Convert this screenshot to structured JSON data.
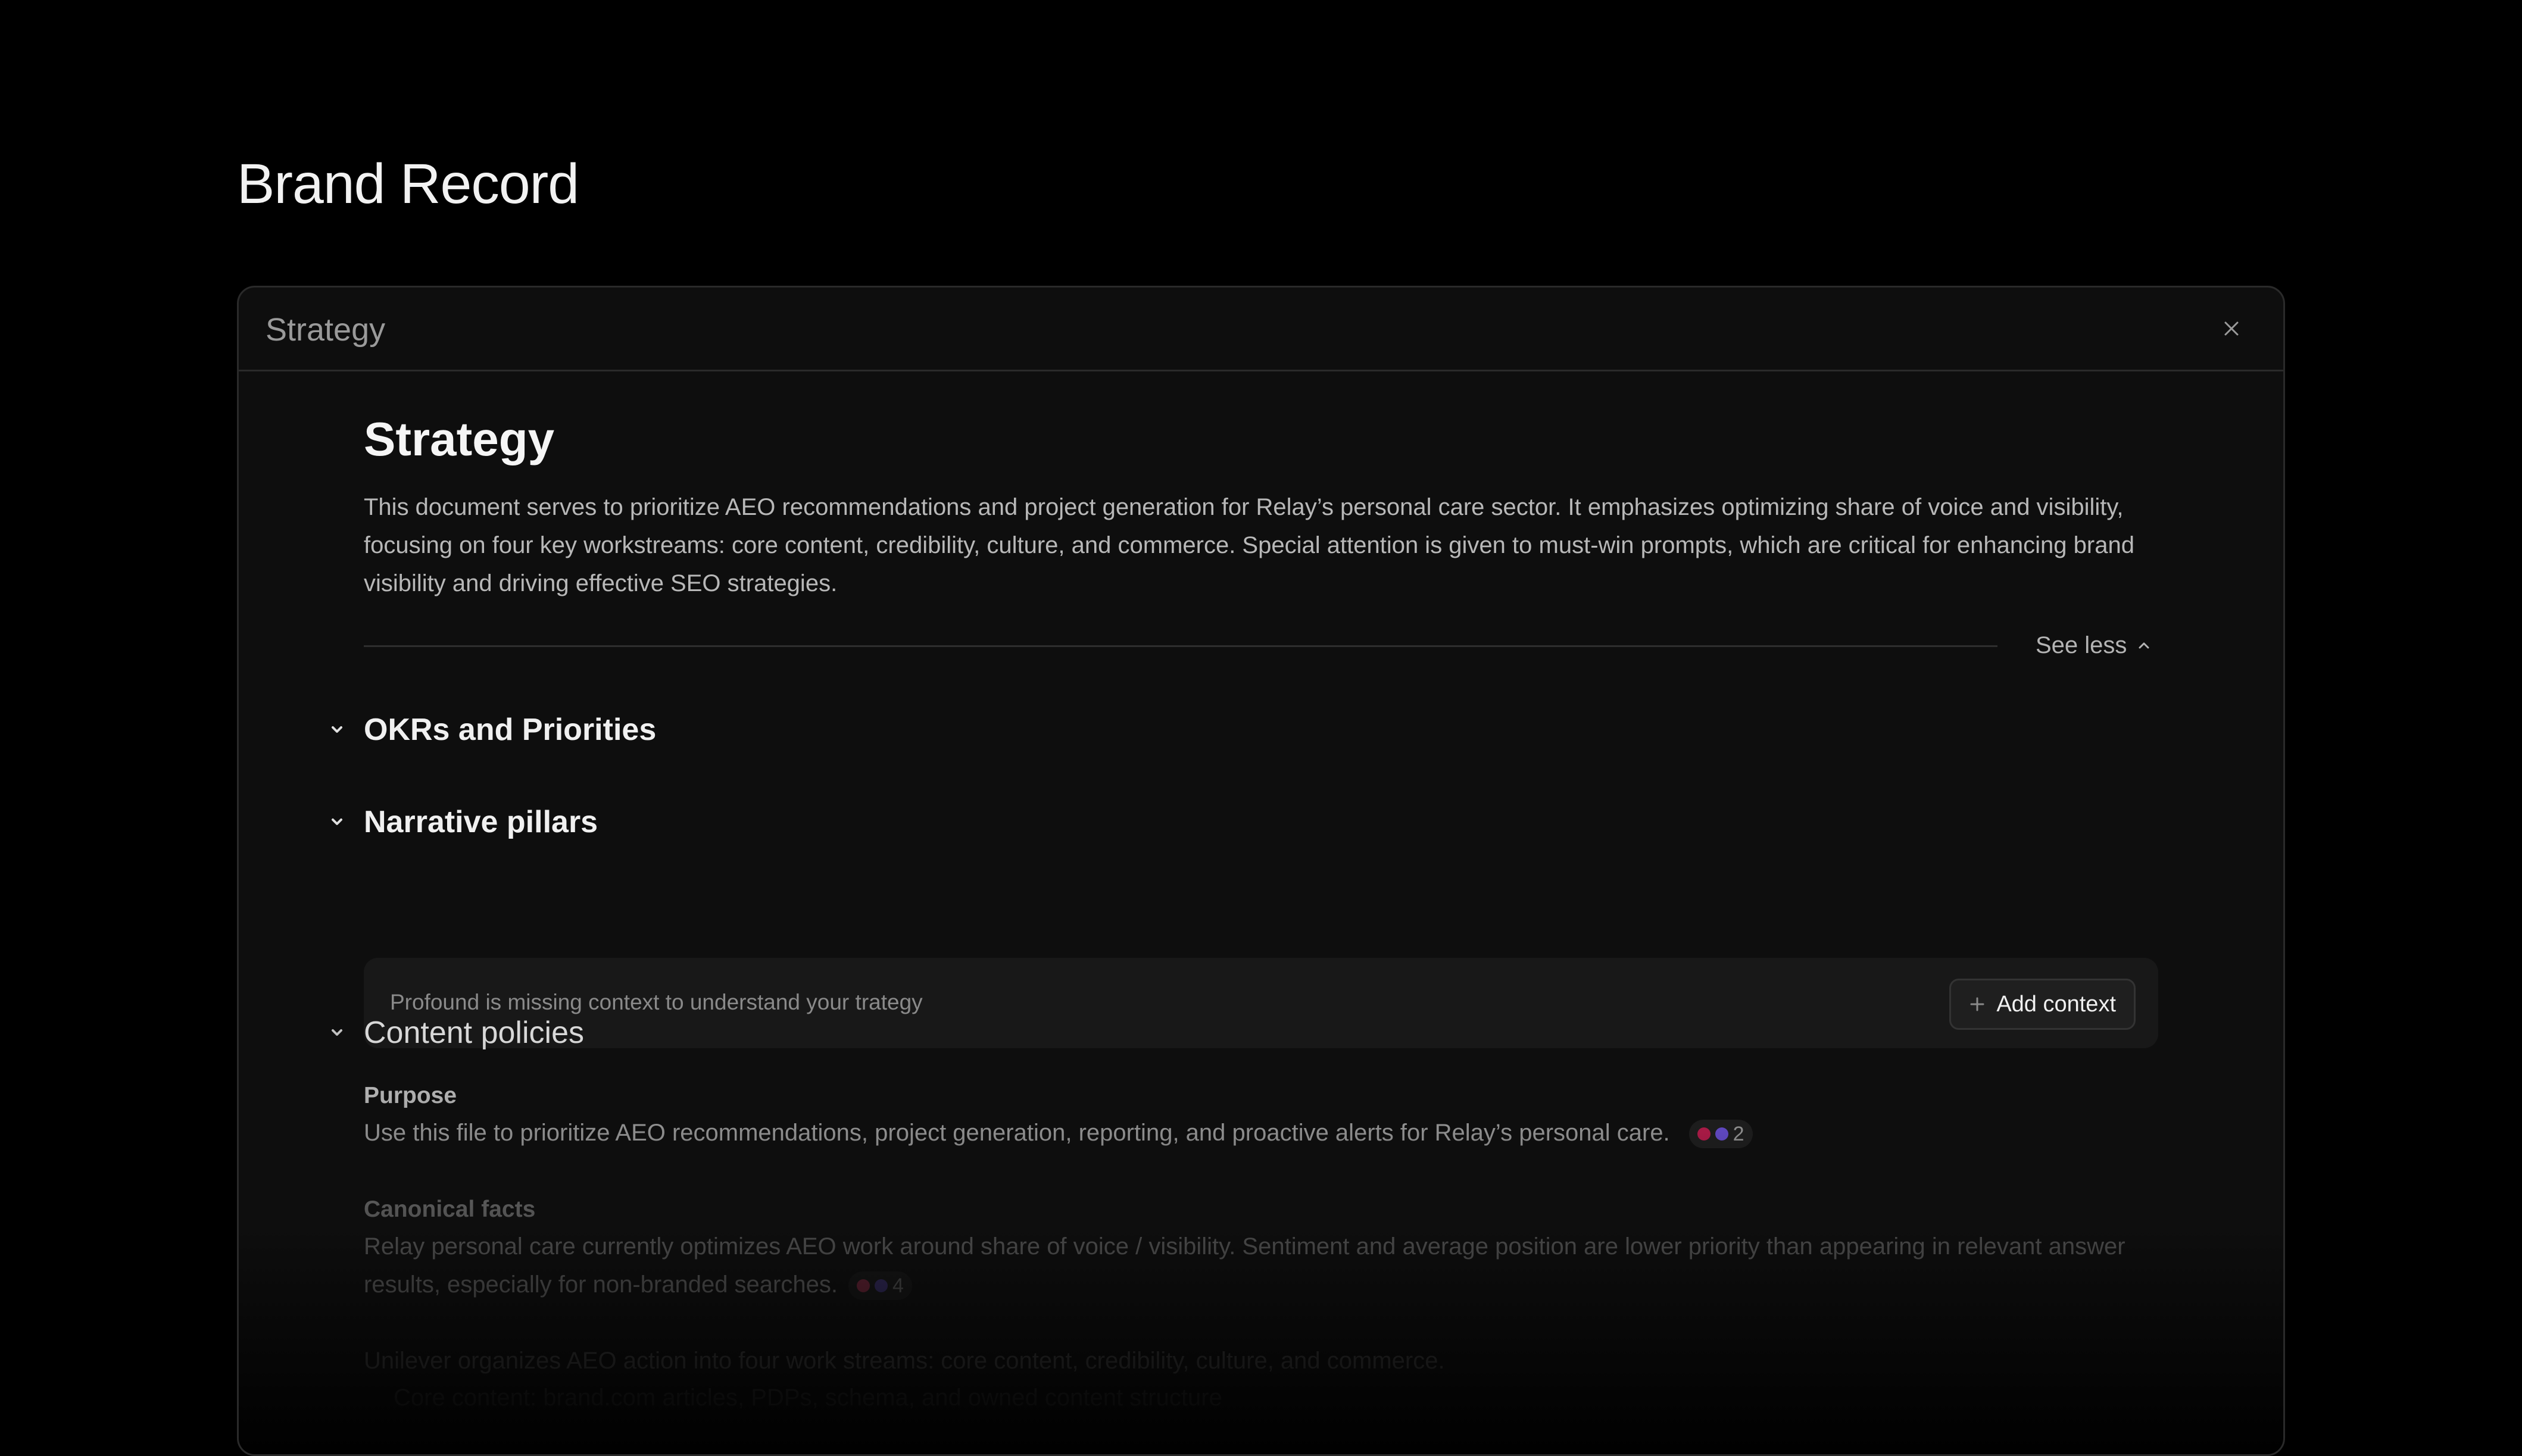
{
  "page": {
    "title": "Brand Record"
  },
  "panel": {
    "header_title": "Strategy",
    "close_icon": "close-icon"
  },
  "document": {
    "title": "Strategy",
    "description": "This document serves to prioritize AEO recommendations and project generation for Relay’s personal care sector. It emphasizes optimizing share of voice and visibility, focusing on four key workstreams: core content, credibility, culture, and commerce. Special attention is given to must-win prompts, which are critical for enhancing brand visibility and driving effective SEO strategies.",
    "see_less_label": "See less"
  },
  "sections": {
    "okrs": {
      "label": "OKRs and Priorities"
    },
    "narrative": {
      "label": "Narrative pillars",
      "missing_text": "Profound is missing context to understand your trategy",
      "add_context_label": "Add context"
    },
    "policies": {
      "label": "Content policies",
      "purpose": {
        "label": "Purpose",
        "text": "Use this file to prioritize AEO recommendations, project generation, reporting, and proactive alerts for Relay’s personal care.",
        "source_count": "2"
      },
      "canonical": {
        "label": "Canonical facts",
        "text": "Relay personal care currently optimizes AEO work around share of voice / visibility. Sentiment and average position are lower priority than appearing in relevant answer results, especially for non-branded searches.",
        "source_count": "4"
      },
      "workstreams": {
        "text": "Unilever organizes AEO action into four work streams: core content, credibility, culture, and commerce.",
        "bullet": "Core content: brand.com articles, PDPs, schema, and owned content structure"
      }
    }
  },
  "colors": {
    "background": "#000000",
    "panel": "#0e0e0e",
    "slack_icon": "#e01e5a",
    "source_icon_purple": "#7c5cff"
  }
}
